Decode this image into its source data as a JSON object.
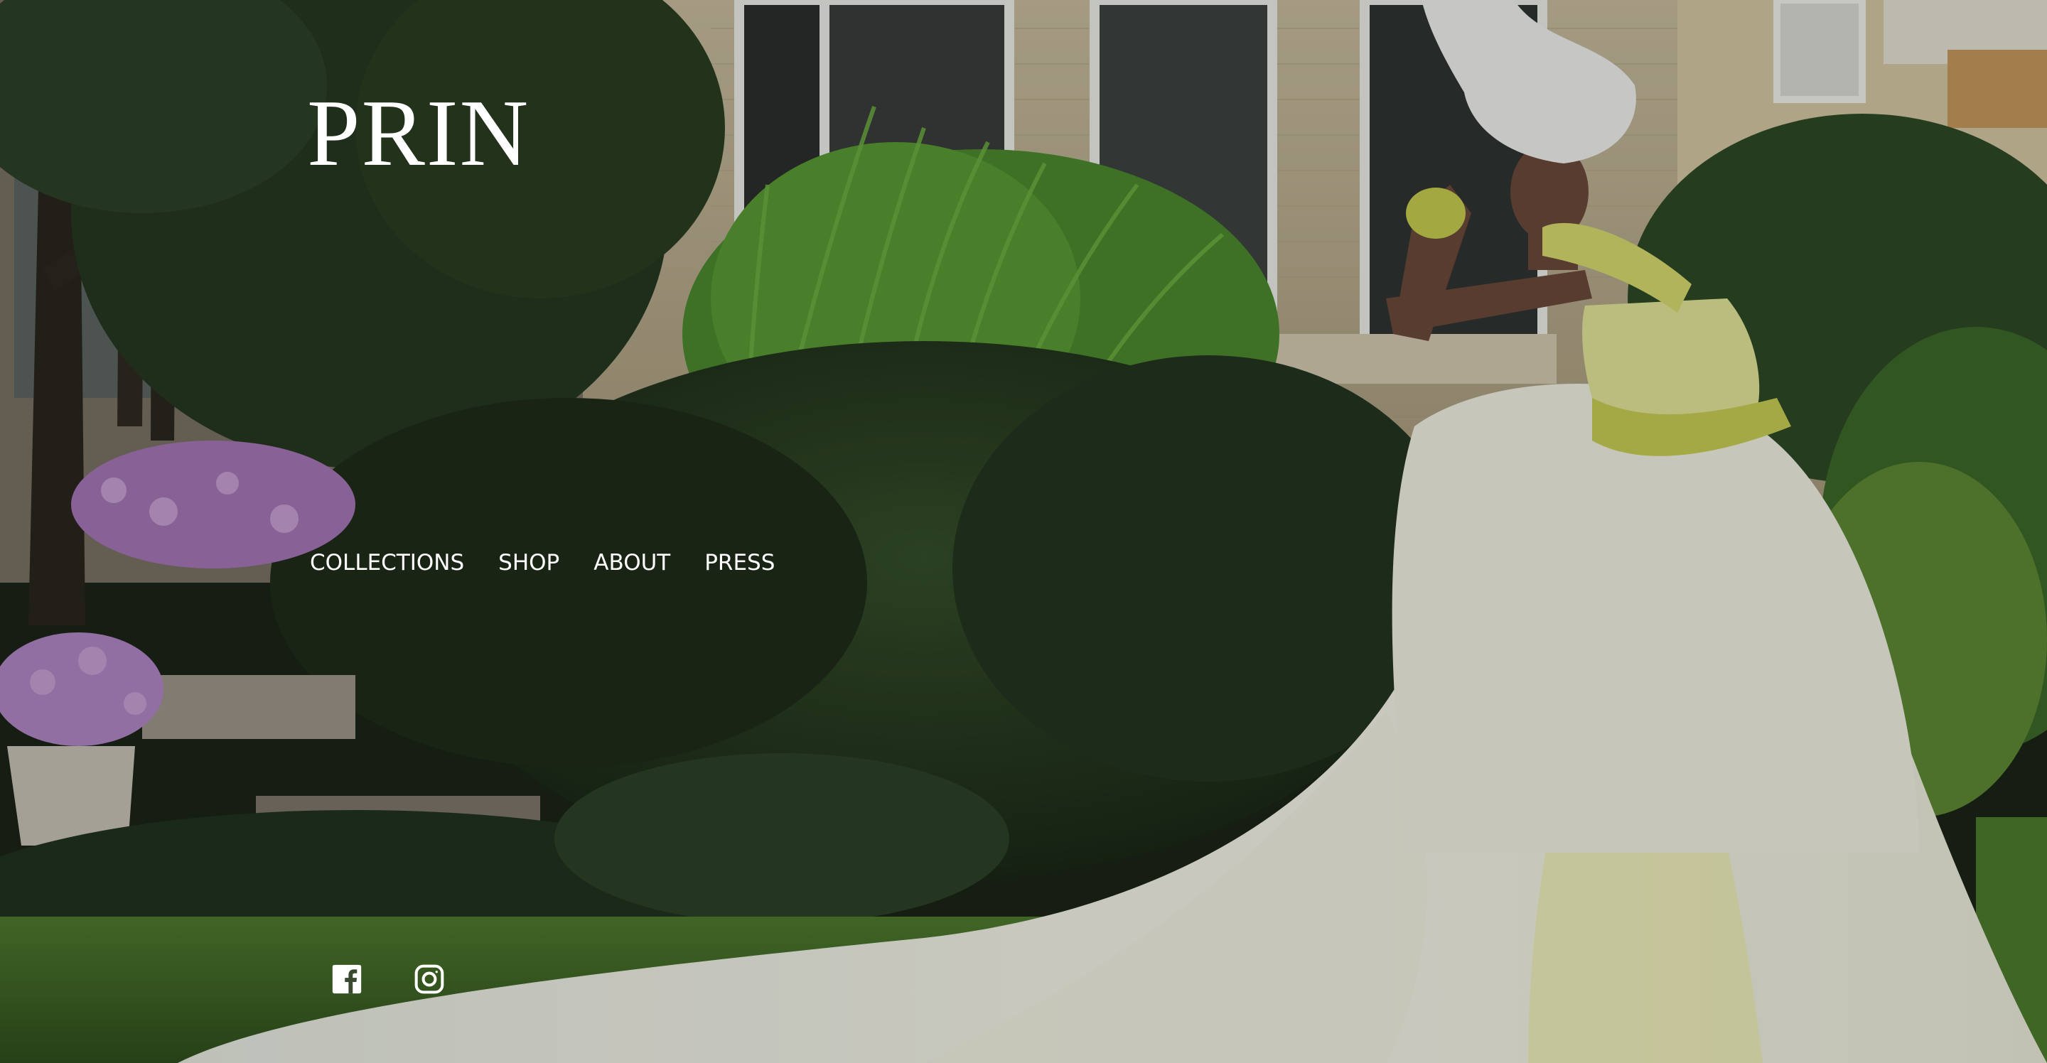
{
  "site": {
    "logo_text": "PRIN"
  },
  "nav": {
    "items": [
      {
        "label": "COLLECTIONS"
      },
      {
        "label": "SHOP"
      },
      {
        "label": "ABOUT"
      },
      {
        "label": "PRESS"
      }
    ]
  },
  "social": {
    "icons": [
      "facebook-icon",
      "instagram-icon"
    ]
  },
  "colors": {
    "text": "#ffffff",
    "foliage_dark": "#1e2a1a",
    "foliage_green": "#3f6a2a",
    "grass": "#4d7a2c",
    "brick": "#c9bc9c",
    "gown": "#f6f4e6",
    "gown_accent": "#e2e690"
  }
}
